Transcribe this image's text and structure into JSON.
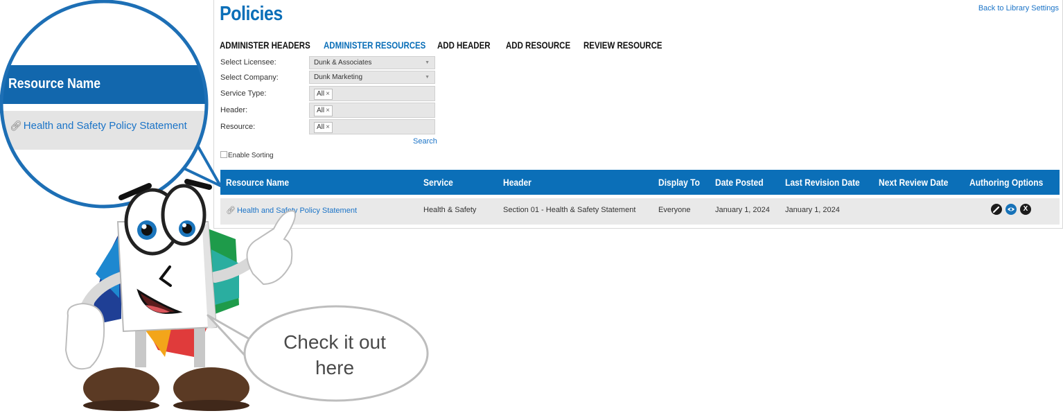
{
  "page": {
    "title": "Policies",
    "back_link": "Back to Library Settings"
  },
  "tabs": [
    {
      "label": "ADMINISTER HEADERS",
      "active": false
    },
    {
      "label": "ADMINISTER RESOURCES",
      "active": true
    },
    {
      "label": "ADD HEADER",
      "active": false
    },
    {
      "label": "ADD RESOURCE",
      "active": false
    },
    {
      "label": "REVIEW RESOURCE",
      "active": false
    }
  ],
  "filters": {
    "licensee_label": "Select Licensee:",
    "licensee_value": "Dunk & Associates",
    "company_label": "Select Company:",
    "company_value": "Dunk Marketing",
    "service_label": "Service Type:",
    "service_token": "All",
    "header_label": "Header:",
    "header_token": "All",
    "resource_label": "Resource:",
    "resource_token": "All",
    "token_remove": "×",
    "search": "Search",
    "enable_sorting": "Enable Sorting"
  },
  "table": {
    "columns": [
      "Resource Name",
      "Service",
      "Header",
      "Display To",
      "Date Posted",
      "Last Revision Date",
      "Next Review Date",
      "Authoring Options"
    ],
    "rows": [
      {
        "resource_name": "Health and Safety Policy Statement",
        "service": "Health & Safety",
        "header": "Section 01 - Health & Safety Statement",
        "display_to": "Everyone",
        "date_posted": "January 1, 2024",
        "last_revision": "January 1, 2024",
        "next_review": "",
        "actions": {
          "edit_icon": "pencil-icon",
          "view_icon": "eye-icon",
          "delete_icon": "x-icon",
          "delete_glyph": "X"
        }
      }
    ]
  },
  "callout": {
    "header": "Resource Name",
    "link": "Health and Safety Policy Statement"
  },
  "mascot": {
    "speech": "Check it out here"
  },
  "colors": {
    "brand_blue": "#0b6fb8",
    "link_blue": "#1a73c7",
    "row_gray": "#e9e9e9"
  }
}
